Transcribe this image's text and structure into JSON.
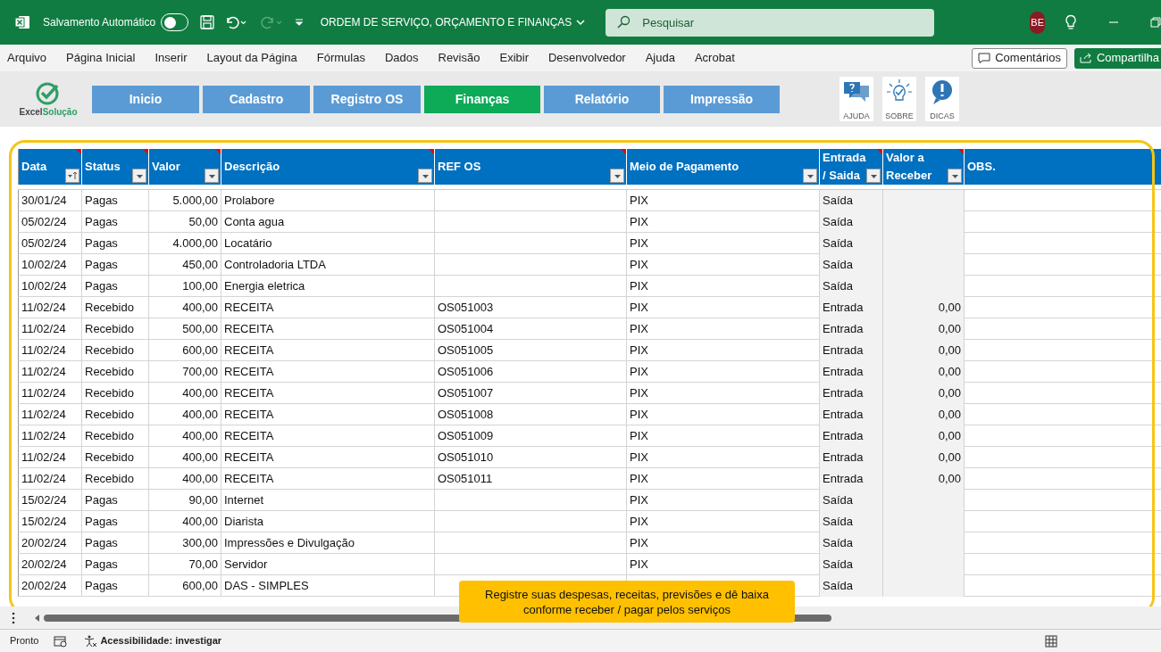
{
  "title_bar": {
    "autosave_label": "Salvamento Automático",
    "autosave_on": false,
    "document_title": "ORDEM DE SERVIÇO, ORÇAMENTO E FINANÇAS",
    "search_placeholder": "Pesquisar",
    "avatar_initials": "BE"
  },
  "menu": {
    "items": [
      "Arquivo",
      "Página Inicial",
      "Inserir",
      "Layout da Página",
      "Fórmulas",
      "Dados",
      "Revisão",
      "Exibir",
      "Desenvolvedor",
      "Ajuda",
      "Acrobat"
    ],
    "comments_button": "Comentários",
    "share_button": "Compartilha"
  },
  "toolbar": {
    "logo_text_1": "Excel",
    "logo_text_2": "Solução",
    "nav_buttons": [
      {
        "label": "Inicio",
        "selected": false
      },
      {
        "label": "Cadastro",
        "selected": false
      },
      {
        "label": "Registro OS",
        "selected": false
      },
      {
        "label": "Finanças",
        "selected": true
      },
      {
        "label": "Relatório",
        "selected": false
      },
      {
        "label": "Impressão",
        "selected": false
      }
    ],
    "help_buttons": [
      {
        "kind": "question",
        "label": "AJUDA"
      },
      {
        "kind": "bulb",
        "label": "SOBRE"
      },
      {
        "kind": "exclamation",
        "label": "DICAS"
      }
    ]
  },
  "table": {
    "columns": [
      {
        "label": "Data",
        "filter": true,
        "sorted": true,
        "comment": true,
        "kind": "text"
      },
      {
        "label": "Status",
        "filter": true,
        "sorted": false,
        "comment": true,
        "kind": "text"
      },
      {
        "label": "Valor",
        "filter": true,
        "sorted": false,
        "comment": true,
        "kind": "number"
      },
      {
        "label": "Descrição",
        "filter": true,
        "sorted": false,
        "comment": true,
        "kind": "text"
      },
      {
        "label": "REF OS",
        "filter": true,
        "sorted": false,
        "comment": true,
        "kind": "text"
      },
      {
        "label": "Meio de Pagamento",
        "filter": true,
        "sorted": false,
        "comment": false,
        "kind": "text"
      },
      {
        "label": "Entrada / Saida",
        "filter": true,
        "sorted": false,
        "comment": true,
        "kind": "formula-text"
      },
      {
        "label": "Valor a Receber",
        "filter": true,
        "sorted": false,
        "comment": true,
        "kind": "formula-number"
      },
      {
        "label": "OBS.",
        "filter": false,
        "sorted": false,
        "comment": false,
        "kind": "text"
      }
    ],
    "rows": [
      [
        "30/01/24",
        "Pagas",
        "5.000,00",
        "Prolabore",
        null,
        "PIX",
        "Saída",
        null,
        null
      ],
      [
        "05/02/24",
        "Pagas",
        "50,00",
        "Conta agua",
        null,
        "PIX",
        "Saída",
        null,
        null
      ],
      [
        "05/02/24",
        "Pagas",
        "4.000,00",
        "Locatário",
        null,
        "PIX",
        "Saída",
        null,
        null
      ],
      [
        "10/02/24",
        "Pagas",
        "450,00",
        "Controladoria LTDA",
        null,
        "PIX",
        "Saída",
        null,
        null
      ],
      [
        "10/02/24",
        "Pagas",
        "100,00",
        "Energia eletrica",
        null,
        "PIX",
        "Saída",
        null,
        null
      ],
      [
        "11/02/24",
        "Recebido",
        "400,00",
        "RECEITA",
        "OS051003",
        "PIX",
        "Entrada",
        "0,00",
        null
      ],
      [
        "11/02/24",
        "Recebido",
        "500,00",
        "RECEITA",
        "OS051004",
        "PIX",
        "Entrada",
        "0,00",
        null
      ],
      [
        "11/02/24",
        "Recebido",
        "600,00",
        "RECEITA",
        "OS051005",
        "PIX",
        "Entrada",
        "0,00",
        null
      ],
      [
        "11/02/24",
        "Recebido",
        "700,00",
        "RECEITA",
        "OS051006",
        "PIX",
        "Entrada",
        "0,00",
        null
      ],
      [
        "11/02/24",
        "Recebido",
        "400,00",
        "RECEITA",
        "OS051007",
        "PIX",
        "Entrada",
        "0,00",
        null
      ],
      [
        "11/02/24",
        "Recebido",
        "400,00",
        "RECEITA",
        "OS051008",
        "PIX",
        "Entrada",
        "0,00",
        null
      ],
      [
        "11/02/24",
        "Recebido",
        "400,00",
        "RECEITA",
        "OS051009",
        "PIX",
        "Entrada",
        "0,00",
        null
      ],
      [
        "11/02/24",
        "Recebido",
        "400,00",
        "RECEITA",
        "OS051010",
        "PIX",
        "Entrada",
        "0,00",
        null
      ],
      [
        "11/02/24",
        "Recebido",
        "400,00",
        "RECEITA",
        "OS051011",
        "PIX",
        "Entrada",
        "0,00",
        null
      ],
      [
        "15/02/24",
        "Pagas",
        "90,00",
        "Internet",
        null,
        "PIX",
        "Saída",
        null,
        null
      ],
      [
        "15/02/24",
        "Pagas",
        "400,00",
        "Diarista",
        null,
        "PIX",
        "Saída",
        null,
        null
      ],
      [
        "20/02/24",
        "Pagas",
        "300,00",
        "Impressões e Divulgação",
        null,
        "PIX",
        "Saída",
        null,
        null
      ],
      [
        "20/02/24",
        "Pagas",
        "70,00",
        "Servidor",
        null,
        "PIX",
        "Saída",
        null,
        null
      ],
      [
        "20/02/24",
        "Pagas",
        "600,00",
        "DAS - SIMPLES",
        null,
        null,
        "Saída",
        null,
        null
      ]
    ]
  },
  "callout": "Registre suas despesas, receitas, previsões e dê baixa conforme receber / pagar pelos serviços",
  "status_bar": {
    "ready": "Pronto",
    "accessibility": "Acessibilidade: investigar"
  }
}
